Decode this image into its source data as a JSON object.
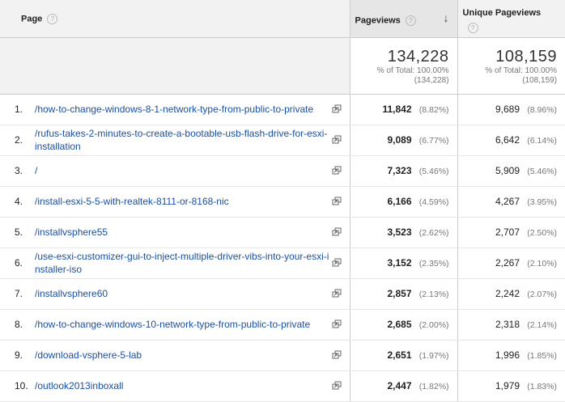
{
  "header": {
    "page": "Page",
    "pageviews": "Pageviews",
    "unique_pageviews": "Unique Pageviews",
    "help_icon": "question-help-icon",
    "sort_icon": "sort-descending-arrow-icon"
  },
  "totals": {
    "pageviews": "134,228",
    "pageviews_pct": "% of Total: 100.00%",
    "pageviews_total": "(134,228)",
    "unique_pageviews": "108,159",
    "unique_pct": "% of Total: 100.00%",
    "unique_total": "(108,159)"
  },
  "rows": [
    {
      "n": "1.",
      "page": "/how-to-change-windows-8-1-network-type-from-public-to-private",
      "pv": "11,842",
      "pv_pct": "(8.82%)",
      "upv": "9,689",
      "upv_pct": "(8.96%)"
    },
    {
      "n": "2.",
      "page": "/rufus-takes-2-minutes-to-create-a-bootable-usb-flash-drive-for-esxi-installation",
      "pv": "9,089",
      "pv_pct": "(6.77%)",
      "upv": "6,642",
      "upv_pct": "(6.14%)"
    },
    {
      "n": "3.",
      "page": "/",
      "pv": "7,323",
      "pv_pct": "(5.46%)",
      "upv": "5,909",
      "upv_pct": "(5.46%)"
    },
    {
      "n": "4.",
      "page": "/install-esxi-5-5-with-realtek-8111-or-8168-nic",
      "pv": "6,166",
      "pv_pct": "(4.59%)",
      "upv": "4,267",
      "upv_pct": "(3.95%)"
    },
    {
      "n": "5.",
      "page": "/installvsphere55",
      "pv": "3,523",
      "pv_pct": "(2.62%)",
      "upv": "2,707",
      "upv_pct": "(2.50%)"
    },
    {
      "n": "6.",
      "page": "/use-esxi-customizer-gui-to-inject-multiple-driver-vibs-into-your-esxi-installer-iso",
      "pv": "3,152",
      "pv_pct": "(2.35%)",
      "upv": "2,267",
      "upv_pct": "(2.10%)"
    },
    {
      "n": "7.",
      "page": "/installvsphere60",
      "pv": "2,857",
      "pv_pct": "(2.13%)",
      "upv": "2,242",
      "upv_pct": "(2.07%)"
    },
    {
      "n": "8.",
      "page": "/how-to-change-windows-10-network-type-from-public-to-private",
      "pv": "2,685",
      "pv_pct": "(2.00%)",
      "upv": "2,318",
      "upv_pct": "(2.14%)"
    },
    {
      "n": "9.",
      "page": "/download-vsphere-5-lab",
      "pv": "2,651",
      "pv_pct": "(1.97%)",
      "upv": "1,996",
      "upv_pct": "(1.85%)"
    },
    {
      "n": "10.",
      "page": "/outlook2013inboxall",
      "pv": "2,447",
      "pv_pct": "(1.82%)",
      "upv": "1,979",
      "upv_pct": "(1.83%)"
    }
  ]
}
